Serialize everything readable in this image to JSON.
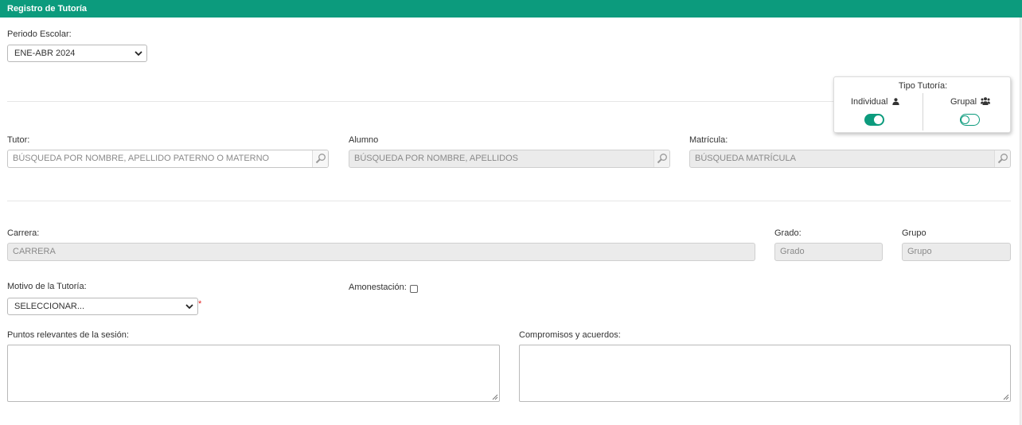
{
  "header": {
    "title": "Registro de Tutoría"
  },
  "periodo": {
    "label": "Periodo Escolar:",
    "selected": "ENE-ABR 2024"
  },
  "tipo_tutoria": {
    "title": "Tipo Tutoría:",
    "individual_label": "Individual",
    "grupal_label": "Grupal",
    "individual_on": true,
    "grupal_on": false
  },
  "tutor": {
    "label": "Tutor:",
    "placeholder": "BÚSQUEDA POR NOMBRE, APELLIDO PATERNO O MATERNO"
  },
  "alumno": {
    "label": "Alumno",
    "placeholder": "BÚSQUEDA POR NOMBRE, APELLIDOS"
  },
  "matricula": {
    "label": "Matrícula:",
    "placeholder": "BÚSQUEDA MATRÍCULA"
  },
  "carrera": {
    "label": "Carrera:",
    "value": "CARRERA"
  },
  "grado": {
    "label": "Grado:",
    "value": "Grado"
  },
  "grupo": {
    "label": "Grupo",
    "value": "Grupo"
  },
  "motivo": {
    "label": "Motivo de la Tutoría:",
    "selected": "SELECCIONAR...",
    "required_mark": "*"
  },
  "amonestacion": {
    "label": "Amonestación:",
    "checked": false
  },
  "puntos": {
    "label": "Puntos relevantes de la sesión:"
  },
  "compromisos": {
    "label": "Compromisos y acuerdos:"
  },
  "colors": {
    "accent": "#0c9b7d",
    "required": "#e02020"
  }
}
